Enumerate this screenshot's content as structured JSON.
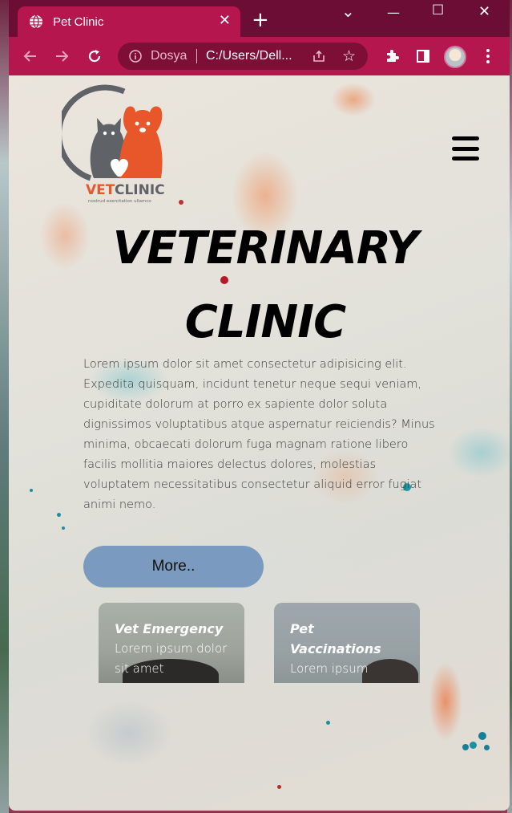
{
  "browser": {
    "tab_title": "Pet Clinic",
    "tab_close": "✕",
    "new_tab": "+",
    "window_controls": {
      "minimize": "—",
      "maximize": "☐",
      "close": "✕",
      "dropdown": "⌄"
    },
    "omnibox": {
      "label": "Dosya",
      "url": "C:/Users/Dell..."
    },
    "icons": [
      "back-icon",
      "forward-icon",
      "reload-icon",
      "info-icon",
      "share-icon",
      "star-icon",
      "extensions-icon",
      "sidepanel-icon",
      "profile-avatar",
      "menu-icon"
    ]
  },
  "site": {
    "logo_text": "VETCLINIC",
    "logo_tagline": "nostrud exercitation ullamco",
    "hero": {
      "title_line1": "VETERINARY",
      "title_line2": "CLINIC",
      "body": "Lorem ipsum dolor sit amet consectetur adipisicing elit. Expedita quisquam, incidunt tenetur neque sequi veniam, cupiditate dolorum at porro ex sapiente dolor soluta dignissimos voluptatibus atque aspernatur reiciendis? Minus minima, obcaecati dolorum fuga magnam ratione libero facilis mollitia maiores delectus dolores, molestias voluptatem necessitatibus consectetur aliquid error fugiat animi nemo.",
      "more_button": "More.."
    },
    "cards": [
      {
        "title": "Vet Emergency",
        "text": "Lorem ipsum dolor sit amet"
      },
      {
        "title": "Pet Vaccinations",
        "text": "Lorem ipsum"
      }
    ]
  },
  "colors": {
    "browser_frame": "#b5164e",
    "tab_strip": "#6b0d34",
    "more_button": "#7a9bbf",
    "logo_orange": "#e8572a",
    "logo_gray": "#5f6266"
  }
}
